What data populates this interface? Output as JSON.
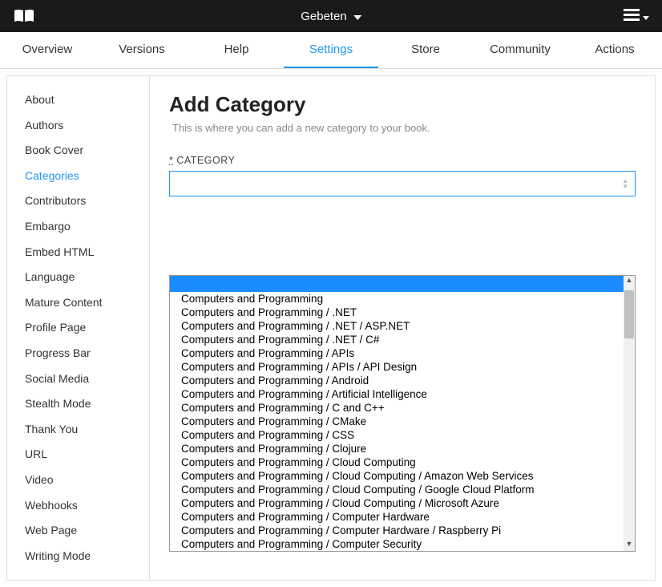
{
  "header": {
    "title": "Gebeten"
  },
  "tabs": [
    {
      "label": "Overview"
    },
    {
      "label": "Versions"
    },
    {
      "label": "Help"
    },
    {
      "label": "Settings"
    },
    {
      "label": "Store"
    },
    {
      "label": "Community"
    },
    {
      "label": "Actions"
    }
  ],
  "active_tab": 3,
  "sidebar": {
    "items": [
      {
        "label": "About"
      },
      {
        "label": "Authors"
      },
      {
        "label": "Book Cover"
      },
      {
        "label": "Categories"
      },
      {
        "label": "Contributors"
      },
      {
        "label": "Embargo"
      },
      {
        "label": "Embed HTML"
      },
      {
        "label": "Language"
      },
      {
        "label": "Mature Content"
      },
      {
        "label": "Profile Page"
      },
      {
        "label": "Progress Bar"
      },
      {
        "label": "Social Media"
      },
      {
        "label": "Stealth Mode"
      },
      {
        "label": "Thank You"
      },
      {
        "label": "URL"
      },
      {
        "label": "Video"
      },
      {
        "label": "Webhooks"
      },
      {
        "label": "Web Page"
      },
      {
        "label": "Writing Mode"
      }
    ],
    "active": 3
  },
  "main": {
    "title": "Add Category",
    "description": "This is where you can add a new category to your book.",
    "field": {
      "required_marker": "*",
      "label": "CATEGORY",
      "value": ""
    },
    "options": [
      "",
      "Computers and Programming",
      "Computers and Programming / .NET",
      "Computers and Programming / .NET / ASP.NET",
      "Computers and Programming / .NET / C#",
      "Computers and Programming / APIs",
      "Computers and Programming / APIs / API Design",
      "Computers and Programming / Android",
      "Computers and Programming / Artificial Intelligence",
      "Computers and Programming / C and C++",
      "Computers and Programming / CMake",
      "Computers and Programming / CSS",
      "Computers and Programming / Clojure",
      "Computers and Programming / Cloud Computing",
      "Computers and Programming / Cloud Computing / Amazon Web Services",
      "Computers and Programming / Cloud Computing / Google Cloud Platform",
      "Computers and Programming / Cloud Computing / Microsoft Azure",
      "Computers and Programming / Computer Hardware",
      "Computers and Programming / Computer Hardware / Raspberry Pi",
      "Computers and Programming / Computer Security"
    ]
  }
}
